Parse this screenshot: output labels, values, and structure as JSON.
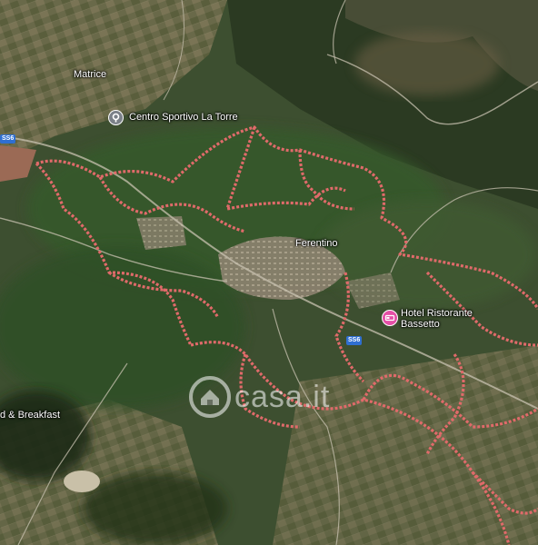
{
  "map": {
    "type": "satellite",
    "places": {
      "matrice": "Matrice",
      "ferentino": "Ferentino",
      "bnb": "d & Breakfast"
    },
    "pois": {
      "sport_center": "Centro Sportivo La Torre",
      "hotel_line1": "Hotel Ristorante",
      "hotel_line2": "Bassetto"
    },
    "road_shields": {
      "left": "SS6",
      "center": "SS6"
    },
    "watermark": "casa.it",
    "colors": {
      "boundary": "#e06a6a",
      "hotel_pin": "#e44fa6",
      "road_shield": "#2f6fd1"
    }
  }
}
